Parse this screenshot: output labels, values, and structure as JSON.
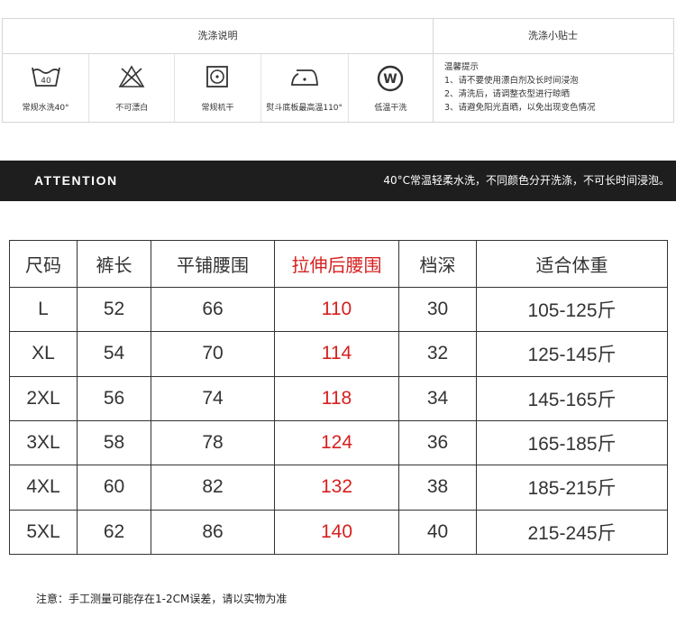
{
  "care": {
    "header_left": "洗涤说明",
    "header_right": "洗涤小贴士",
    "icons": [
      {
        "icon": "wash-40-icon",
        "label": "常规水洗40°"
      },
      {
        "icon": "no-bleach-icon",
        "label": "不可漂白"
      },
      {
        "icon": "tumble-dry-icon",
        "label": "常规机干"
      },
      {
        "icon": "iron-icon",
        "label": "熨斗底板最高温110°"
      },
      {
        "icon": "dry-clean-w-icon",
        "label": "低温干洗"
      }
    ],
    "tips": {
      "title": "温馨提示",
      "items": [
        "1、请不要使用漂白剂及长时间浸泡",
        "2、清洗后，请调整衣型进行晾晒",
        "3、请避免阳光直晒，以免出现变色情况"
      ]
    }
  },
  "attention": {
    "title": "ATTENTION",
    "message": "40°C常温轻柔水洗，不同颜色分开洗涤，不可长时间浸泡。"
  },
  "size_table": {
    "headers": [
      "尺码",
      "裤长",
      "平铺腰围",
      "拉伸后腰围",
      "档深",
      "适合体重"
    ],
    "rows": [
      [
        "L",
        "52",
        "66",
        "110",
        "30",
        "105-125斤"
      ],
      [
        "XL",
        "54",
        "70",
        "114",
        "32",
        "125-145斤"
      ],
      [
        "2XL",
        "56",
        "74",
        "118",
        "34",
        "145-165斤"
      ],
      [
        "3XL",
        "58",
        "78",
        "124",
        "36",
        "165-185斤"
      ],
      [
        "4XL",
        "60",
        "82",
        "132",
        "38",
        "185-215斤"
      ],
      [
        "5XL",
        "62",
        "86",
        "140",
        "40",
        "215-245斤"
      ]
    ],
    "highlight_color": "#d6201f"
  },
  "note": "注意：手工测量可能存在1-2CM误差，请以实物为准"
}
